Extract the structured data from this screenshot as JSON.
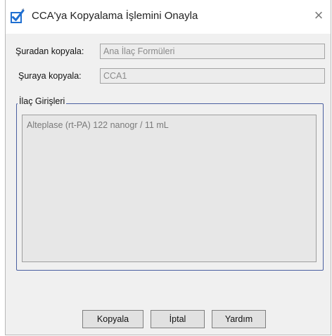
{
  "dialog": {
    "title": "CCA'ya Kopyalama İşlemini Onayla",
    "close_glyph": "×",
    "icon": "checkbox-checked-icon"
  },
  "form": {
    "source_label": "Şuradan kopyala:",
    "source_value": "Ana İlaç Formüleri",
    "target_label": "Şuraya kopyala:",
    "target_value": "CCA1"
  },
  "group": {
    "title": "İlaç Girişleri",
    "items": [
      "Alteplase (rt-PA) 122 nanogr / 11 mL"
    ]
  },
  "buttons": {
    "copy": "Kopyala",
    "cancel": "İptal",
    "help": "Yardım"
  },
  "colors": {
    "accent": "#1f6fd1",
    "group_border": "#4a5fa0"
  }
}
